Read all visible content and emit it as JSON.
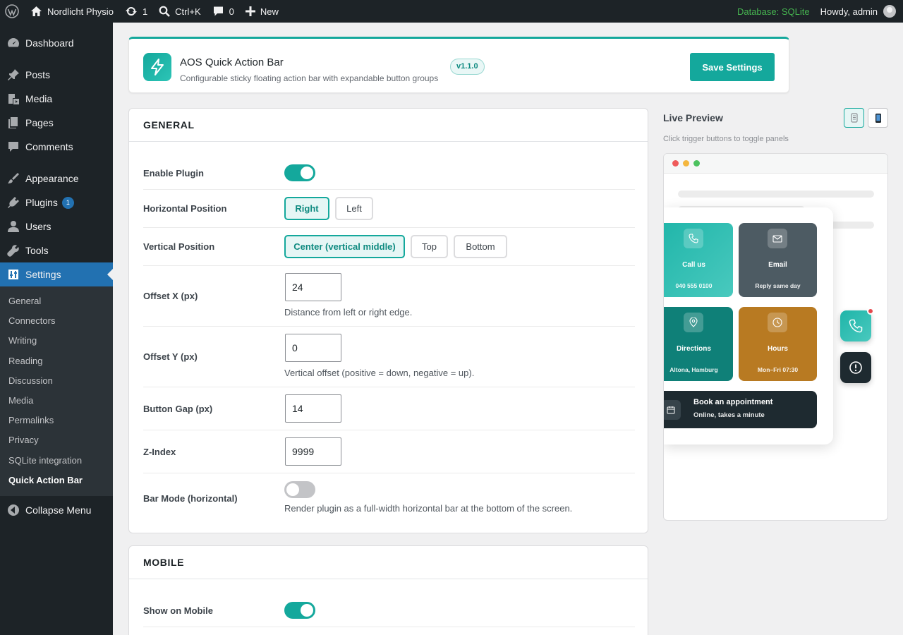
{
  "adminbar": {
    "site_name": "Nordlicht Physio",
    "updates_count": "1",
    "search_shortcut": "Ctrl+K",
    "comments_count": "0",
    "new_label": "New",
    "db_label": "Database: SQLite",
    "howdy": "Howdy, admin"
  },
  "sidebar": {
    "items": [
      {
        "label": "Dashboard",
        "icon": "dashboard-icon"
      },
      {
        "label": "Posts",
        "icon": "pin-icon"
      },
      {
        "label": "Media",
        "icon": "media-icon"
      },
      {
        "label": "Pages",
        "icon": "pages-icon"
      },
      {
        "label": "Comments",
        "icon": "comment-icon"
      },
      {
        "label": "Appearance",
        "icon": "brush-icon"
      },
      {
        "label": "Plugins",
        "icon": "plugin-icon",
        "badge": "1"
      },
      {
        "label": "Users",
        "icon": "user-icon"
      },
      {
        "label": "Tools",
        "icon": "wrench-icon"
      },
      {
        "label": "Settings",
        "icon": "settings-icon"
      }
    ],
    "submenu": [
      "General",
      "Connectors",
      "Writing",
      "Reading",
      "Discussion",
      "Media",
      "Permalinks",
      "Privacy",
      "SQLite integration",
      "Quick Action Bar"
    ],
    "collapse_label": "Collapse Menu"
  },
  "header": {
    "title": "AOS Quick Action Bar",
    "subtitle": "Configurable sticky floating action bar with expandable button groups",
    "version": "v1.1.0",
    "save_label": "Save Settings"
  },
  "general": {
    "heading": "GENERAL",
    "enable_label": "Enable Plugin",
    "enable_on": true,
    "hpos_label": "Horizontal Position",
    "hpos_options": [
      "Right",
      "Left"
    ],
    "hpos_selected": "Right",
    "vpos_label": "Vertical Position",
    "vpos_options": [
      "Center (vertical middle)",
      "Top",
      "Bottom"
    ],
    "vpos_selected": "Center (vertical middle)",
    "offx_label": "Offset X (px)",
    "offx_value": "24",
    "offx_help": "Distance from left or right edge.",
    "offy_label": "Offset Y (px)",
    "offy_value": "0",
    "offy_help": "Vertical offset (positive = down, negative = up).",
    "gap_label": "Button Gap (px)",
    "gap_value": "14",
    "z_label": "Z-Index",
    "z_value": "9999",
    "bar_label": "Bar Mode (horizontal)",
    "bar_on": false,
    "bar_help": "Render plugin as a full-width horizontal bar at the bottom of the screen."
  },
  "mobile": {
    "heading": "MOBILE",
    "show_label": "Show on Mobile",
    "show_on": true
  },
  "preview": {
    "title": "Live Preview",
    "subtitle": "Click trigger buttons to toggle panels",
    "tiles": [
      {
        "title": "Call us",
        "sub": "040 555 0100",
        "color": "#2cbdb1",
        "icon": "phone-icon"
      },
      {
        "title": "Email",
        "sub": "Reply same day",
        "color": "#4d5b63",
        "icon": "mail-icon"
      },
      {
        "title": "Directions",
        "sub": "Altona, Hamburg",
        "color": "#0f8078",
        "icon": "location-icon"
      },
      {
        "title": "Hours",
        "sub": "Mon–Fri 07:30",
        "color": "#b87a22",
        "icon": "clock-icon"
      }
    ],
    "book_title": "Book an appointment",
    "book_sub": "Online, takes a minute"
  },
  "colors": {
    "accent": "#14a89c",
    "admin_dark": "#1d2327",
    "active_menu": "#2271b1"
  }
}
